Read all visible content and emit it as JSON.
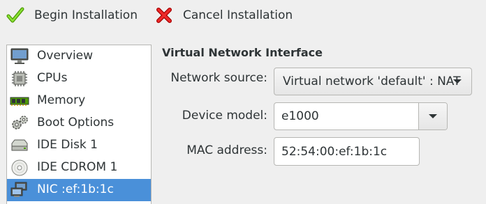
{
  "toolbar": {
    "begin_label": "Begin Installation",
    "cancel_label": "Cancel Installation",
    "begin_icon": "check-icon",
    "cancel_icon": "red-x-icon"
  },
  "sidebar": {
    "items": [
      {
        "label": "Overview",
        "icon": "monitor-icon"
      },
      {
        "label": "CPUs",
        "icon": "cpu-icon"
      },
      {
        "label": "Memory",
        "icon": "memory-icon"
      },
      {
        "label": "Boot Options",
        "icon": "gears-icon"
      },
      {
        "label": "IDE Disk 1",
        "icon": "disk-icon"
      },
      {
        "label": "IDE CDROM 1",
        "icon": "cdrom-icon"
      },
      {
        "label": "NIC :ef:1b:1c",
        "icon": "network-icon",
        "selected": true
      }
    ]
  },
  "details": {
    "title": "Virtual Network Interface",
    "network_source_label": "Network source:",
    "network_source_value": "Virtual network 'default' : NAT",
    "device_model_label": "Device model:",
    "device_model_value": "e1000",
    "mac_label": "MAC address:",
    "mac_value": "52:54:00:ef:1b:1c"
  },
  "colors": {
    "selection": "#4a90d9",
    "window_bg": "#efefef",
    "check_green": "#6ab53a",
    "cancel_red": "#e0302a"
  }
}
